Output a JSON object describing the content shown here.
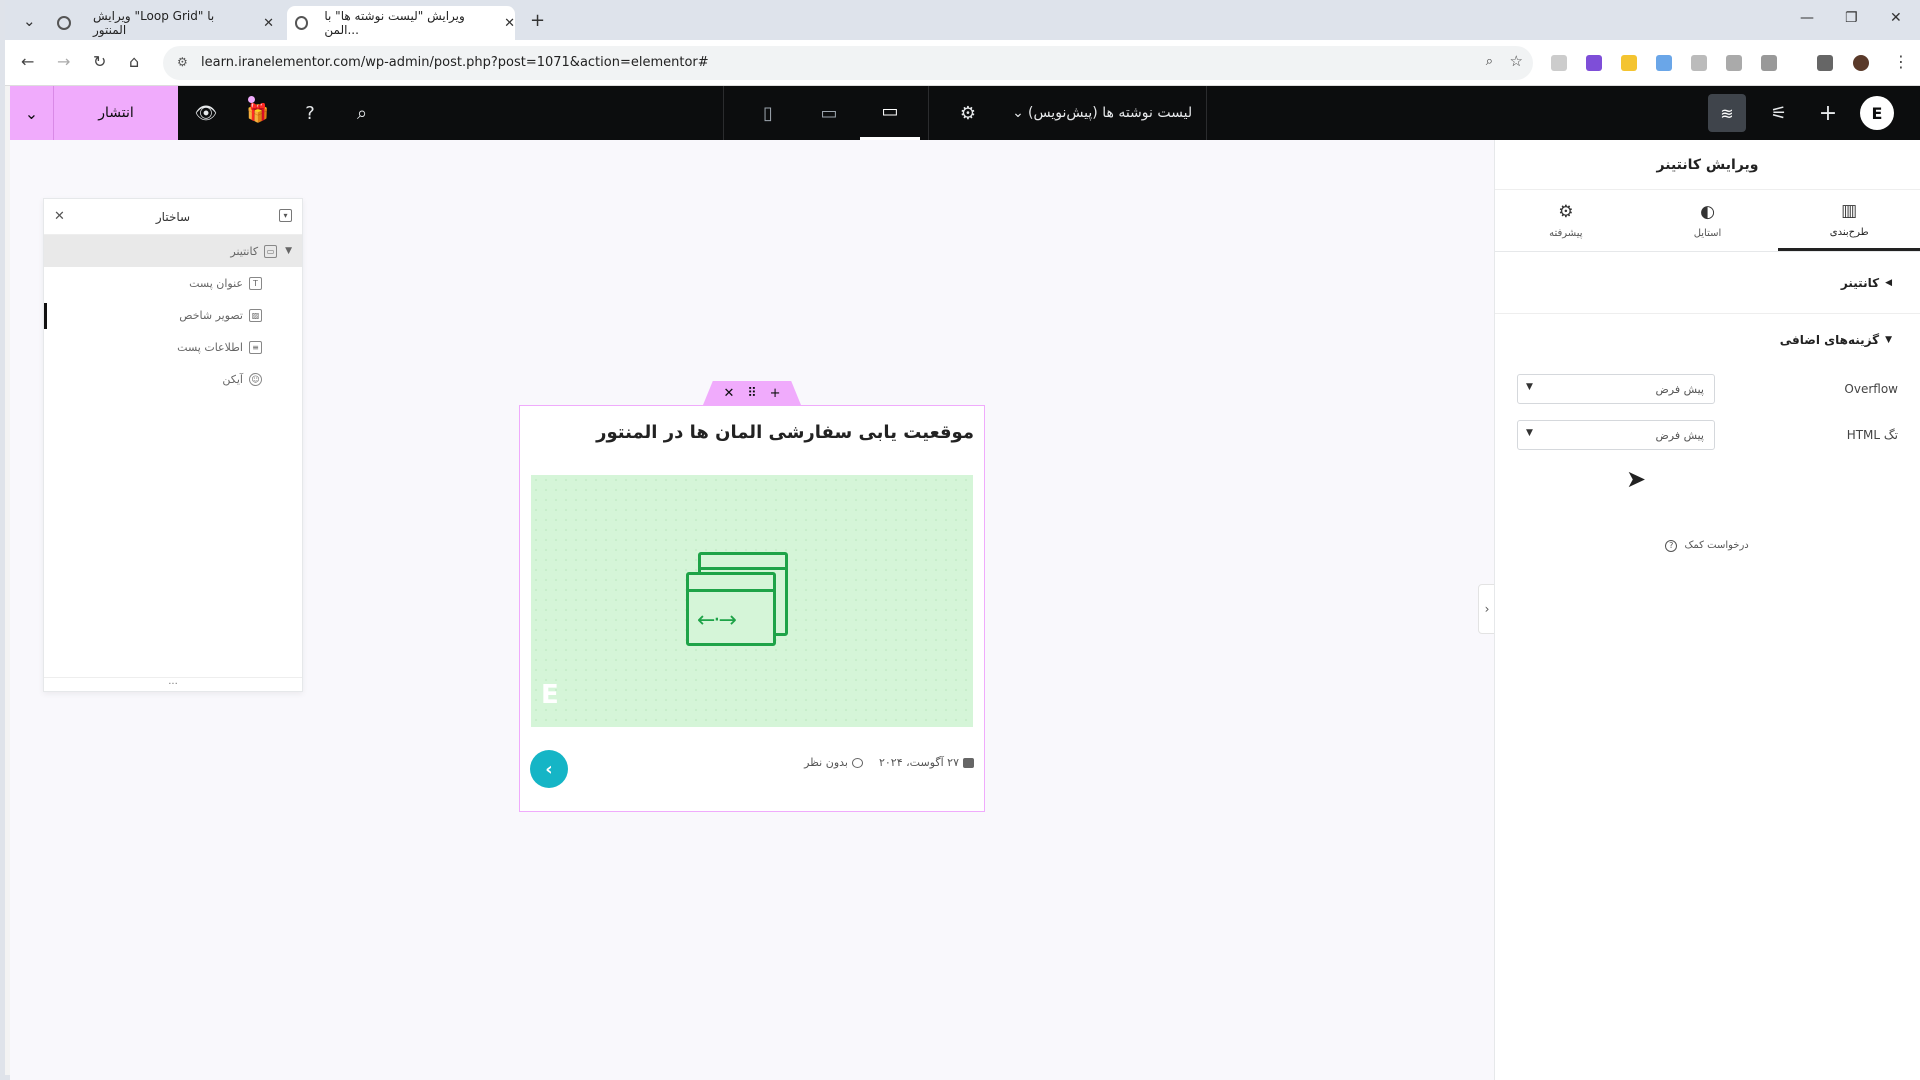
{
  "browser": {
    "tabs": [
      {
        "label": "ویرایش \"Loop Grid\" با المنتور",
        "close": "✕"
      },
      {
        "label": "ویرایش \"لیست نوشته ها\" با المن...",
        "close": "✕"
      }
    ],
    "new_tab": "+",
    "url": "learn.iranelementor.com/wp-admin/post.php?post=1071&action=elementor#"
  },
  "topbar": {
    "publish": "انتشار",
    "doc_title": "لیست نوشته ها (پیش‌نویس)"
  },
  "navigator": {
    "title": "ساختار",
    "container": "کانتینر",
    "children": [
      "عنوان پست",
      "تصویر شاخص",
      "اطلاعات پست",
      "آیکن"
    ],
    "footer": "..."
  },
  "card": {
    "title": "موقعیت یابی سفارشی المان ها در المنتور",
    "date": "۲۷ آگوست، ۲۰۲۴",
    "comments": "بدون نظر"
  },
  "panel": {
    "title": "ویرایش کانتینر",
    "tabs": [
      {
        "label": "طرح‌بندی",
        "icon": "layout-icon"
      },
      {
        "label": "استایل",
        "icon": "contrast-icon"
      },
      {
        "label": "پیشرفته",
        "icon": "gear-icon"
      }
    ],
    "section_container": "کانتینر",
    "section_additional": "گزینه‌های اضافی",
    "controls": [
      {
        "label": "Overflow",
        "value": "پیش فرض"
      },
      {
        "label": "تگ HTML",
        "value": "پیش فرض"
      }
    ],
    "help": "درخواست کمک"
  },
  "colors": {
    "accent": "#f0abfc",
    "teal": "#15b5c6",
    "green": "#1ea348"
  }
}
